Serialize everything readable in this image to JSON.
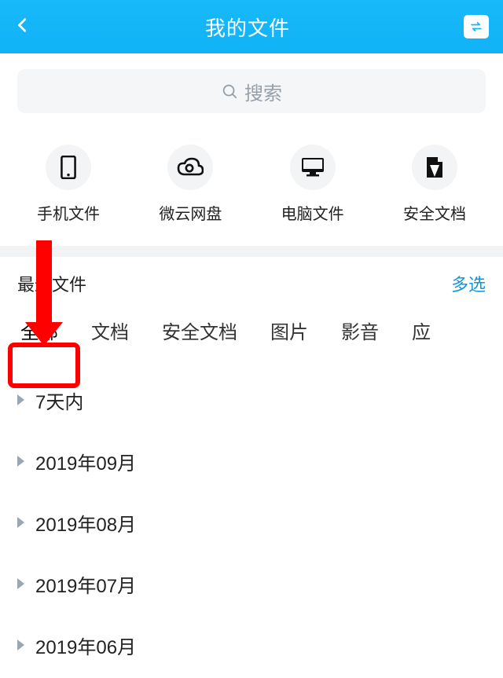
{
  "header": {
    "title": "我的文件"
  },
  "search": {
    "placeholder": "搜索"
  },
  "categories": [
    {
      "name": "phone",
      "label": "手机文件"
    },
    {
      "name": "weiyun",
      "label": "微云网盘"
    },
    {
      "name": "pc",
      "label": "电脑文件"
    },
    {
      "name": "secure",
      "label": "安全文档"
    }
  ],
  "section": {
    "recent_label": "最近文件",
    "multi_select_label": "多选"
  },
  "tabs": [
    {
      "label": "全部",
      "active": true
    },
    {
      "label": "文档",
      "active": false
    },
    {
      "label": "安全文档",
      "active": false
    },
    {
      "label": "图片",
      "active": false
    },
    {
      "label": "影音",
      "active": false
    },
    {
      "label": "应",
      "active": false
    }
  ],
  "groups": [
    {
      "label": "7天内"
    },
    {
      "label": "2019年09月"
    },
    {
      "label": "2019年08月"
    },
    {
      "label": "2019年07月"
    },
    {
      "label": "2019年06月"
    }
  ],
  "annotation": {
    "arrow_points_to_tab_index": 0,
    "highlight_tab_index": 0
  }
}
